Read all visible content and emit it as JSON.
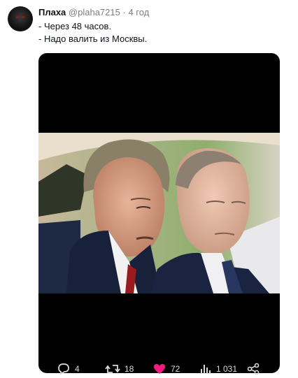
{
  "post": {
    "author_name": "Плаха",
    "author_handle": "@plaha7215",
    "separator": "·",
    "time": "4 год",
    "lines": [
      "- Через 48 часов.",
      "- Надо валить из Москвы."
    ],
    "avatar": "dark-avatar"
  },
  "actions": {
    "replies": "4",
    "reposts": "18",
    "likes": "72",
    "views": "1 031"
  },
  "colors": {
    "like_accent": "#f91880",
    "muted_text": "#7a7f86",
    "action_text_on_black": "#d9d9d9"
  },
  "icons": [
    "reply-icon",
    "repost-icon",
    "like-icon",
    "views-icon",
    "share-icon"
  ]
}
